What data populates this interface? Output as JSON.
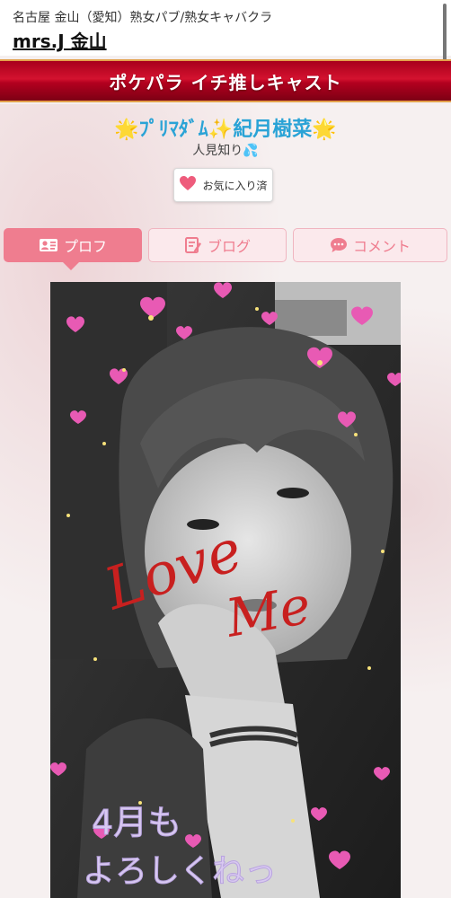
{
  "header": {
    "area_line": "名古屋 金山（愛知）熟女パブ/熟女キャバクラ",
    "shop_name": "mrs.J 金山"
  },
  "banner": {
    "title": "ポケパラ イチ推しキャスト"
  },
  "cast": {
    "name": "ﾌﾟﾘﾏﾀﾞﾑ✨紀月樹菜",
    "tagline": "人見知り"
  },
  "favorite_button": {
    "label": "お気に入り済"
  },
  "tabs": [
    {
      "label": "プロフ",
      "active": true,
      "icon": "profile-card-icon"
    },
    {
      "label": "ブログ",
      "active": false,
      "icon": "blog-edit-icon"
    },
    {
      "label": "コメント",
      "active": false,
      "icon": "speech-bubble-icon"
    }
  ],
  "photo": {
    "overlay_text_1": "Love",
    "overlay_text_2": "Me",
    "overlay_text_3": "4月も",
    "overlay_text_4": "よろしくねっ"
  },
  "colors": {
    "banner_red": "#c8102e",
    "accent_pink": "#ef7d8f",
    "name_blue": "#2aa3d6"
  }
}
